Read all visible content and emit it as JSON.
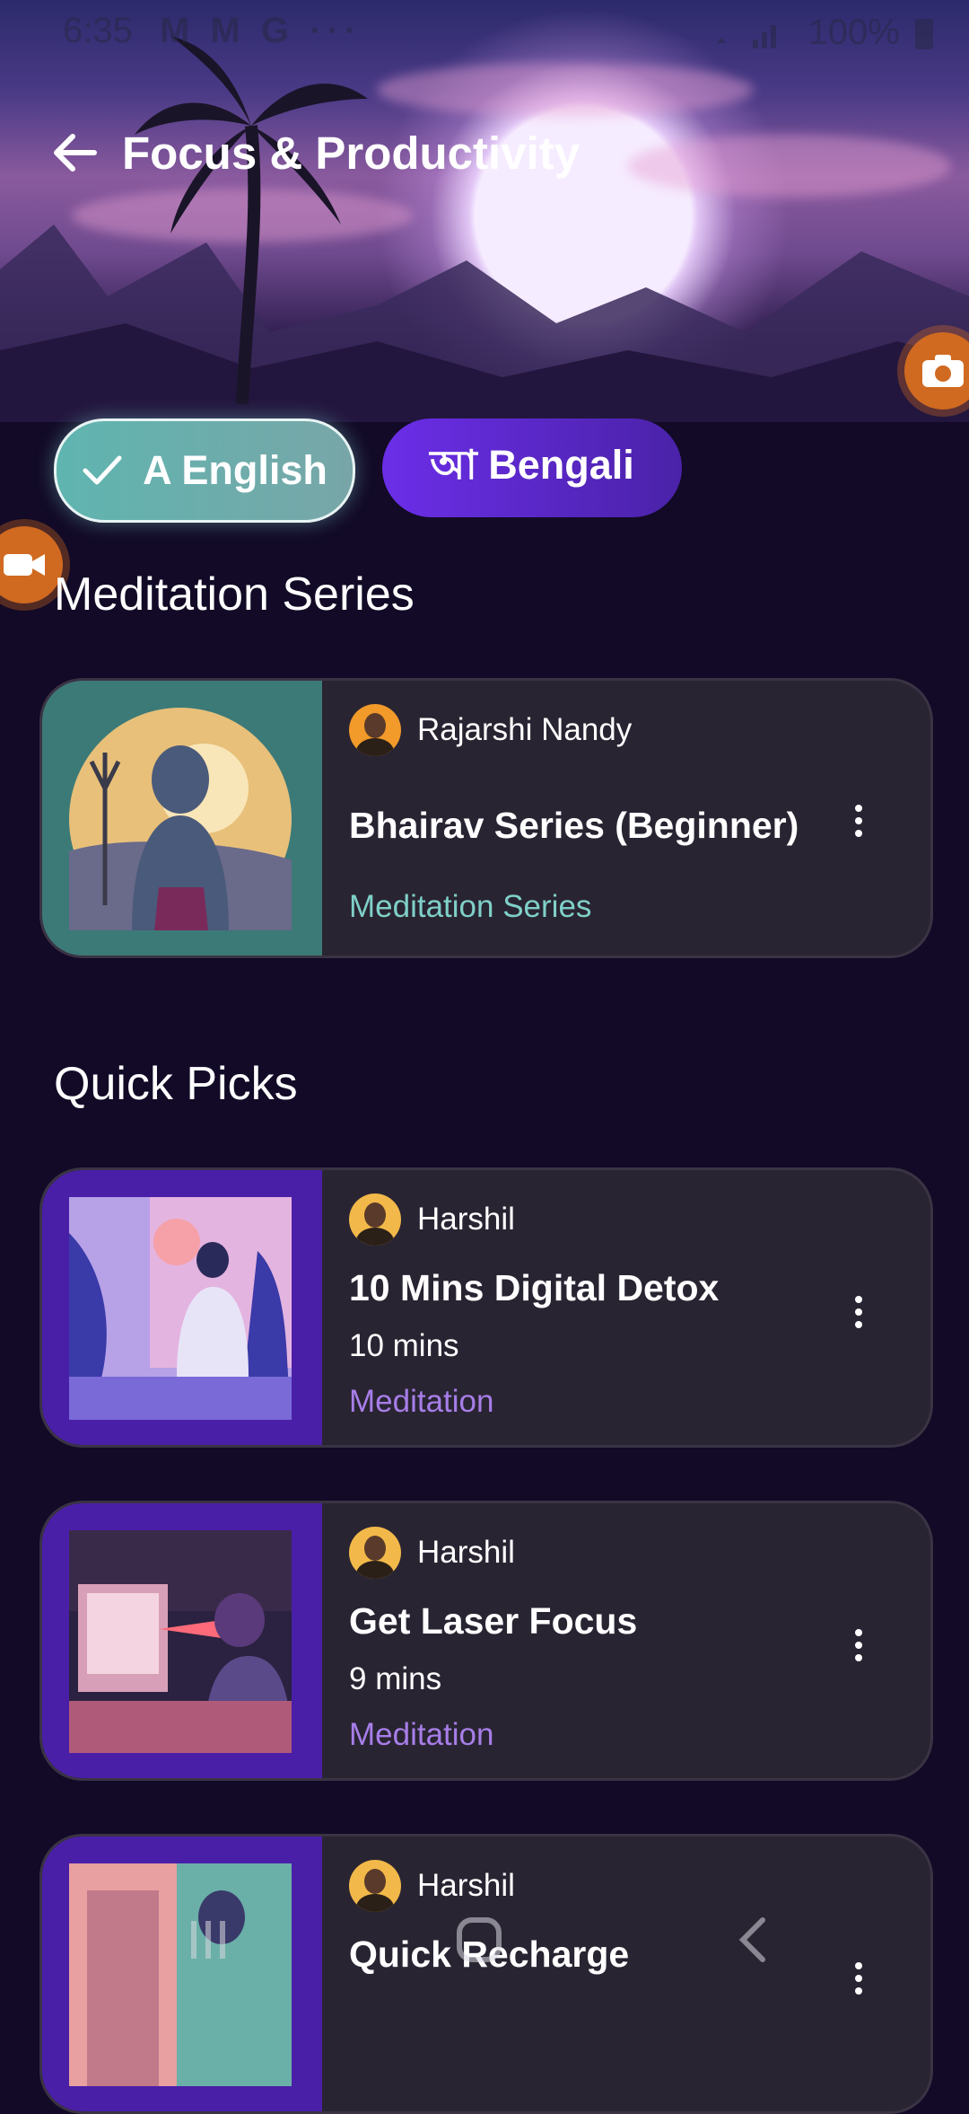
{
  "status_bar": {
    "time": "6:35",
    "left_icons": "M M G ···",
    "battery": "100%"
  },
  "header": {
    "title": "Focus & Productivity",
    "back_icon": "arrow-left-icon"
  },
  "languages": [
    {
      "label": "A English",
      "selected": true
    },
    {
      "label": "আ Bengali",
      "selected": false
    }
  ],
  "sections": {
    "meditation_series": "Meditation Series",
    "quick_picks": "Quick Picks"
  },
  "series_card": {
    "author": "Rajarshi Nandy",
    "title": "Bhairav Series (Beginner)",
    "category": "Meditation Series"
  },
  "quick_picks": [
    {
      "author": "Harshil",
      "title": "10 Mins Digital Detox",
      "duration": "10 mins",
      "category": "Meditation"
    },
    {
      "author": "Harshil",
      "title": "Get Laser Focus",
      "duration": "9 mins",
      "category": "Meditation"
    },
    {
      "author": "Harshil",
      "title": "Quick Recharge"
    }
  ],
  "colors": {
    "background": "#120a26",
    "card": "#292432",
    "teal_accent": "#7fd0c8",
    "purple_accent": "#a77ee8",
    "chip_selected": "#5fb5b0",
    "chip_unselected": "#6b2ee8"
  }
}
